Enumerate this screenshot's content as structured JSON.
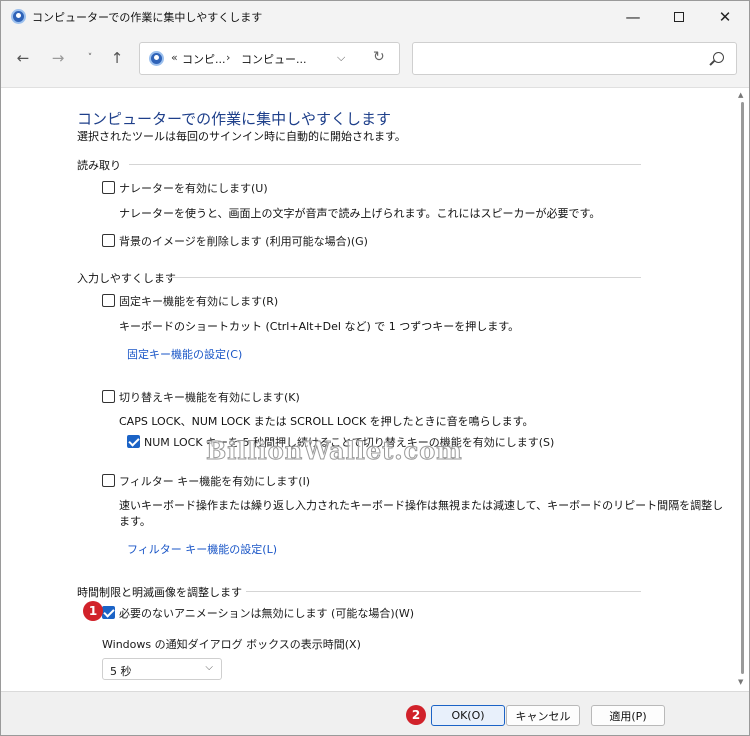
{
  "window": {
    "title": "コンピューターでの作業に集中しやすくします",
    "minimize_icon": "—",
    "close_icon": "✕"
  },
  "nav": {
    "back_icon": "←",
    "forward_icon": "→",
    "recent_icon": "˅",
    "up_icon": "↑",
    "address": {
      "prefix": "«",
      "crumb1": "コンピ...",
      "separator": "›",
      "crumb2": "コンピュー...",
      "chevron": "⌵",
      "refresh_icon": "↻"
    },
    "search": {
      "placeholder": ""
    }
  },
  "page": {
    "title": "コンピューターでの作業に集中しやすくします",
    "subtitle": "選択されたツールは毎回のサインイン時に自動的に開始されます。"
  },
  "sections": {
    "reading": {
      "heading": "読み取り",
      "narrator": {
        "label": "ナレーターを有効にします(U)",
        "checked": false,
        "desc": "ナレーターを使うと、画面上の文字が音声で読み上げられます。これにはスピーカーが必要です。"
      },
      "background": {
        "label": "背景のイメージを削除します (利用可能な場合)(G)",
        "checked": false
      }
    },
    "input": {
      "heading": "入力しやすくします",
      "sticky": {
        "label": "固定キー機能を有効にします(R)",
        "checked": false,
        "desc": "キーボードのショートカット (Ctrl+Alt+Del など) で 1 つずつキーを押します。",
        "link": "固定キー機能の設定(C)"
      },
      "toggle": {
        "label": "切り替えキー機能を有効にします(K)",
        "checked": false,
        "desc": "CAPS LOCK、NUM LOCK または SCROLL LOCK を押したときに音を鳴らします。",
        "sub_label": "NUM LOCK キーを 5 秒間押し続けることで切り替えキーの機能を有効にします(S)",
        "sub_checked": true
      },
      "filter": {
        "label": "フィルター キー機能を有効にします(I)",
        "checked": false,
        "desc_line1": "速いキーボード操作または繰り返し入力されたキーボード操作は無視または減速して、キーボードのリピート間隔を調整し",
        "desc_line2": "ます。",
        "link": "フィルター キー機能の設定(L)"
      }
    },
    "timing": {
      "heading": "時間制限と明滅画像を調整します",
      "animations": {
        "label": "必要のないアニメーションは無効にします (可能な場合)(W)",
        "checked": true
      },
      "notify_label": "Windows の通知ダイアログ ボックスの表示時間(X)",
      "notify_value": "5 秒",
      "notify_chevron": "⌵"
    }
  },
  "markers": {
    "m1": "1",
    "m2": "2"
  },
  "watermark": "BillionWallet.com",
  "footer": {
    "ok": "OK(O)",
    "cancel": "キャンセル",
    "apply": "適用(P)"
  },
  "scrollbar": {
    "up": "▲",
    "down": "▼"
  }
}
